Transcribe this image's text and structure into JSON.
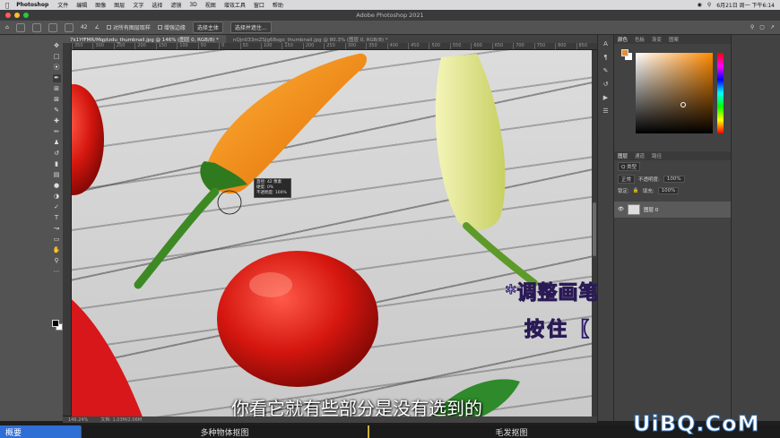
{
  "menubar": {
    "apple": "",
    "app_name": "Photoshop",
    "items": [
      "文件",
      "编辑",
      "图像",
      "图层",
      "文字",
      "选择",
      "滤镜",
      "3D",
      "视图",
      "增效工具",
      "窗口",
      "帮助"
    ],
    "clock": "6月21日 周一 下午6:14"
  },
  "window": {
    "title": "Adobe Photoshop 2021"
  },
  "options": {
    "brush_size": "42",
    "sample_all_layers": "对所有图层取样",
    "enhance_edge": "增强边缘",
    "select_subject": "选择主体",
    "select_and_mask": "选择并遮住..."
  },
  "tabs": [
    {
      "label": "7k1YfFMR/Mqptzdu_thumbnail.jpg @ 146% (图层 0, RGB/8) *",
      "active": true
    },
    {
      "label": "nQjn033mZSJg68sgo_thumbnail.jpg @ 80.3% (图层 0, RGB/8) *",
      "active": false
    }
  ],
  "ruler_ticks": [
    "350",
    "300",
    "250",
    "200",
    "150",
    "100",
    "50",
    "0",
    "50",
    "100",
    "150",
    "200",
    "250",
    "300",
    "350",
    "400",
    "450",
    "500",
    "550",
    "600",
    "650",
    "700",
    "750",
    "800",
    "850"
  ],
  "brush_tooltip": {
    "line1": "直径: 42 像素",
    "line2": "硬度: 0%",
    "line3": "不透明度: 100%"
  },
  "captions": {
    "line1": "*调整画笔大小",
    "line2": "按住【 或 】键"
  },
  "subtitle": "你看它就有些部分是没有选到的",
  "watermark": "UiBQ.CoM",
  "panels": {
    "color_tabs": [
      "颜色",
      "色板",
      "渐变",
      "图案"
    ],
    "layer_tabs": [
      "图层",
      "通道",
      "路径"
    ],
    "kind": "Q 类型",
    "blend_mode": "正常",
    "opacity_label": "不透明度:",
    "opacity": "100%",
    "lock_label": "锁定:",
    "fill_label": "填充:",
    "fill": "100%",
    "layer_name": "图层 0",
    "fg_color": "#e08f3b"
  },
  "status": {
    "zoom": "146.24%",
    "doc": "文档: 1.03M/2.06M"
  },
  "chapters": {
    "active": "概要",
    "items": [
      "多种物体抠图",
      "毛发抠图"
    ]
  }
}
